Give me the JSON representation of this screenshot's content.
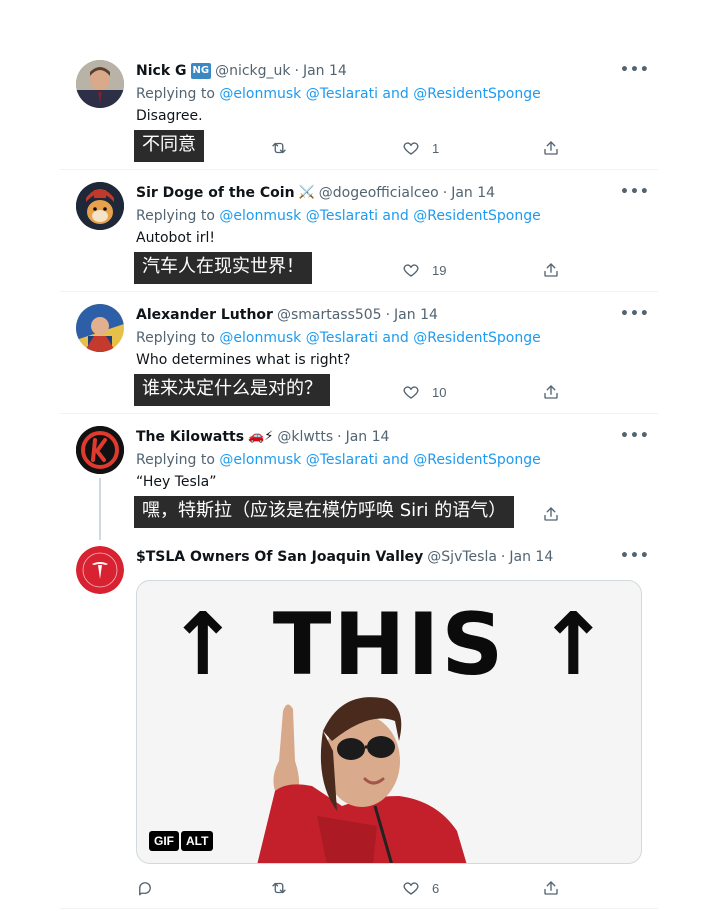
{
  "tweets": [
    {
      "name": "Nick G",
      "badge": "NG",
      "handle": "@nickg_uk",
      "date": "Jan 14",
      "replying_prefix": "Replying to",
      "mention1": "@elonmusk",
      "mention2": "@Teslarati",
      "and_text": "and",
      "mention3": "@ResidentSponge",
      "text": "Disagree.",
      "subtitle": "不同意",
      "like_count": "1"
    },
    {
      "name": "Sir Doge of the Coin",
      "emoji": "⚔️",
      "handle": "@dogeofficialceo",
      "date": "Jan 14",
      "replying_prefix": "Replying to",
      "mention1": "@elonmusk",
      "mention2": "@Teslarati",
      "and_text": "and",
      "mention3": "@ResidentSponge",
      "text": "Autobot irl!",
      "subtitle": "汽车人在现实世界！",
      "like_count": "19"
    },
    {
      "name": "Alexander Luthor",
      "handle": "@smartass505",
      "date": "Jan 14",
      "replying_prefix": "Replying to",
      "mention1": "@elonmusk",
      "mention2": "@Teslarati",
      "and_text": "and",
      "mention3": "@ResidentSponge",
      "text": "Who determines what is right?",
      "subtitle": "谁来决定什么是对的？",
      "like_count": "10"
    },
    {
      "name": "The Kilowatts",
      "emoji": "🚗⚡",
      "handle": "@klwtts",
      "date": "Jan 14",
      "replying_prefix": "Replying to",
      "mention1": "@elonmusk",
      "mention2": "@Teslarati",
      "and_text": "and",
      "mention3": "@ResidentSponge",
      "text": "“Hey Tesla”",
      "subtitle": "嘿，特斯拉（应该是在模仿呼唤 Siri 的语气）"
    },
    {
      "name": "$TSLA Owners Of San Joaquin Valley",
      "handle": "@SjvTesla",
      "date": "Jan 14",
      "media": {
        "gif_text": "↑ THIS ↑",
        "gif_badge": "GIF",
        "alt_badge": "ALT"
      },
      "like_count": "6"
    }
  ],
  "more_label": "•••",
  "avatar_text": {
    "kilowatts": "K"
  },
  "colors": {
    "link": "#1d9bf0",
    "muted": "#536471",
    "subtitle_bg": "#2b2b2b",
    "tesla_red": "#e31937"
  }
}
